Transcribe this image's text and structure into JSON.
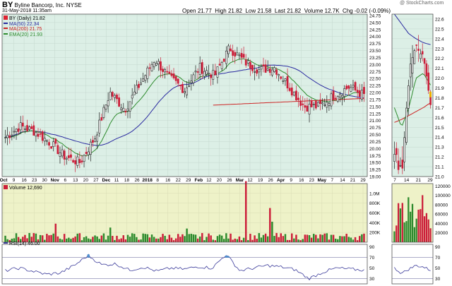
{
  "header": {
    "ticker": "BY",
    "company": "Byline Bancorp, Inc.  NYSE",
    "timestamp": "31-May-2018 11:35am",
    "watermark": "@ StockCharts.com",
    "quote": {
      "open_label": "Open",
      "open": "21.77",
      "high_label": "High",
      "high": "21.82",
      "low_label": "Low",
      "low": "21.58",
      "last_label": "Last",
      "last": "21.82",
      "volume_label": "Volume",
      "volume": "12.7K",
      "chg_label": "Chg",
      "chg": "-0.02 (-0.09%)"
    }
  },
  "legend": [
    {
      "text": "BY (Daily) 21.82",
      "color": "#000000"
    },
    {
      "text": "MA(50) 22.34",
      "color": "#2a2aa0"
    },
    {
      "text": "MA(200) 21.75",
      "color": "#cc2222"
    },
    {
      "text": "EMA(20) 21.93",
      "color": "#2e8b2e"
    }
  ],
  "volume_label": "Volume 12,690",
  "rsi_label": "RSI(14) 46.00",
  "colors": {
    "price_bg": "#dcefe6",
    "volume_bg": "#eef2c8",
    "rsi_bg": "#ffffff",
    "up": "#2e8b2e",
    "down": "#cc1f3a",
    "ma50": "#2a2aa0",
    "ma200": "#cc2222",
    "ema20": "#2e8b2e",
    "rsi_line": "#3a3a9a"
  },
  "chart_data": [
    {
      "type": "candlestick",
      "title": "BY (Daily)",
      "x_labels": [
        "Oct",
        "9",
        "16",
        "23",
        "30",
        "Nov",
        "6",
        "13",
        "20",
        "27",
        "Dec",
        "11",
        "18",
        "26",
        "2018",
        "8",
        "16",
        "22",
        "29",
        "Feb",
        "12",
        "20",
        "26",
        "Mar",
        "12",
        "19",
        "26",
        "Apr",
        "9",
        "16",
        "23",
        "May",
        "7",
        "14",
        "21",
        "29"
      ],
      "y_ticks": [
        "19.00",
        "19.25",
        "19.50",
        "19.75",
        "20.00",
        "20.25",
        "20.50",
        "20.75",
        "21.00",
        "21.25",
        "21.50",
        "21.75",
        "22.00",
        "22.25",
        "22.50",
        "22.75",
        "23.00",
        "23.25",
        "23.50",
        "23.75",
        "24.00",
        "24.25",
        "24.50",
        "24.75"
      ],
      "ylim": [
        19.0,
        24.8
      ],
      "close_waypoints": [
        20.4,
        20.8,
        20.6,
        20.2,
        19.7,
        19.5,
        20.4,
        22.0,
        21.4,
        22.3,
        23.2,
        22.5,
        22.1,
        22.9,
        22.6,
        23.6,
        23.1,
        22.8,
        22.9,
        22.2,
        21.5,
        21.5,
        21.9,
        22.2,
        21.9
      ],
      "series": [
        {
          "name": "MA(50)",
          "last": 22.34
        },
        {
          "name": "MA(200)",
          "last": 21.75
        },
        {
          "name": "EMA(20)",
          "last": 21.93
        }
      ]
    },
    {
      "type": "candlestick",
      "title": "",
      "x_labels": [
        "7",
        "14",
        "21",
        "29"
      ],
      "y_ticks": [
        "21.0",
        "21.1",
        "21.2",
        "21.3",
        "21.4",
        "21.5",
        "21.6",
        "21.7",
        "21.8",
        "21.9",
        "22.0",
        "22.1",
        "22.2",
        "22.3",
        "22.4",
        "22.5",
        "22.6"
      ],
      "ylim": [
        21.0,
        22.65
      ],
      "close_waypoints": [
        21.2,
        21.05,
        22.0,
        22.4,
        22.2,
        21.7
      ],
      "series": [
        {
          "name": "MA(50)",
          "values": [
            22.65,
            22.55,
            22.45,
            22.4,
            22.36,
            22.34
          ]
        },
        {
          "name": "MA(200)",
          "values": [
            21.55,
            21.58,
            21.62,
            21.66,
            21.7,
            21.75
          ]
        },
        {
          "name": "EMA(20)",
          "values": [
            21.7,
            21.5,
            21.7,
            22.0,
            22.05,
            21.93
          ]
        }
      ]
    },
    {
      "type": "bar",
      "title": "Volume",
      "y_ticks": [
        "200K",
        "400K",
        "600K",
        "800K",
        "1.0M"
      ],
      "ylim": [
        0,
        1200000
      ],
      "last": 12690,
      "peaks": [
        {
          "at": "Dec 11",
          "value": 380000
        },
        {
          "at": "Mar 12",
          "value": 1250000
        },
        {
          "at": "Mar 19",
          "value": 700000
        }
      ]
    },
    {
      "type": "bar",
      "title": "",
      "y_ticks": [
        "20000",
        "40000",
        "60000",
        "80000",
        "100000",
        "120000"
      ],
      "ylim": [
        0,
        125000
      ],
      "values": [
        20000,
        110000,
        60000,
        90000,
        40000,
        120000,
        60000,
        30000
      ]
    },
    {
      "type": "line",
      "title": "RSI(14)",
      "last": 46.0,
      "y_ticks": [
        "90",
        "70",
        "50",
        "30"
      ],
      "ylim": [
        20,
        95
      ],
      "reference_lines": [
        70,
        30
      ],
      "waypoints": [
        45,
        50,
        44,
        38,
        41,
        55,
        74,
        56,
        58,
        46,
        52,
        44,
        50,
        48,
        53,
        50,
        76,
        45,
        50,
        55,
        52,
        47,
        30,
        42,
        50,
        48,
        46
      ]
    }
  ]
}
